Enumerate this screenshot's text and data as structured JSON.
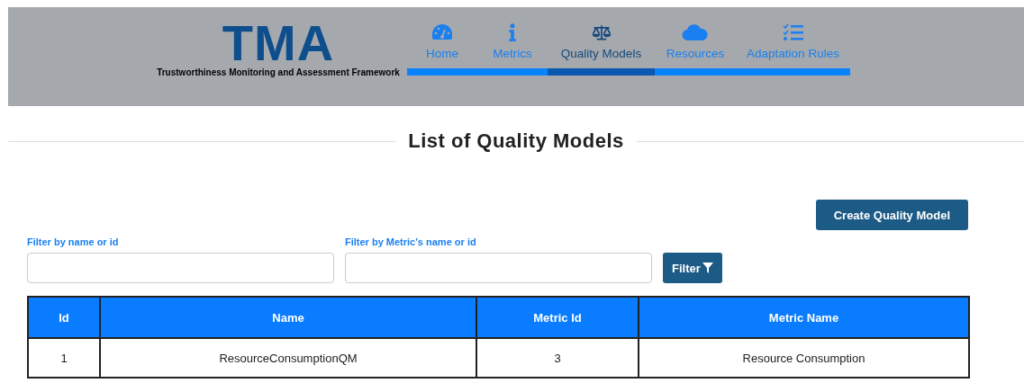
{
  "header": {
    "logo": "TMA",
    "tagline": "Trustworthiness Monitoring and Assessment Framework",
    "nav": [
      {
        "label": "Home",
        "selected": false
      },
      {
        "label": "Metrics",
        "selected": false
      },
      {
        "label": "Quality Models",
        "selected": true
      },
      {
        "label": "Resources",
        "selected": false
      },
      {
        "label": "Adaptation Rules",
        "selected": false
      }
    ]
  },
  "page_title": "List of Quality Models",
  "create_button": "Create Quality Model",
  "filters": [
    {
      "label": "Filter by name or id"
    },
    {
      "label": "Filter by Metric's name or id"
    }
  ],
  "filter_button": "Filter",
  "table": {
    "columns": [
      "Id",
      "Name",
      "Metric Id",
      "Metric Name"
    ],
    "rows": [
      [
        "1",
        "ResourceConsumptionQM",
        "3",
        "Resource Consumption"
      ]
    ]
  }
}
